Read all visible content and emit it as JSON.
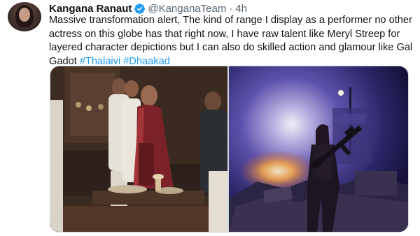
{
  "tweet": {
    "author_name": "Kangana Ranaut",
    "handle": "@KanganaTeam",
    "separator": "·",
    "time": "4h",
    "text": "Massive transformation alert, The kind of range I display as a performer no other actress on this globe has that right now, I have raw talent like Meryl Streep for layered character depictions but I can also do skilled action and glamour like Gal Gadot ",
    "hashtags": [
      "#Thalaivi",
      "#Dhaakad"
    ]
  },
  "icons": {
    "verified": "verified-badge-icon",
    "avatar": "profile-avatar"
  },
  "colors": {
    "hashtag": "#1d9bf0",
    "verified": "#1d9bf0",
    "secondary_text": "#536471"
  },
  "media": {
    "count": 2
  }
}
